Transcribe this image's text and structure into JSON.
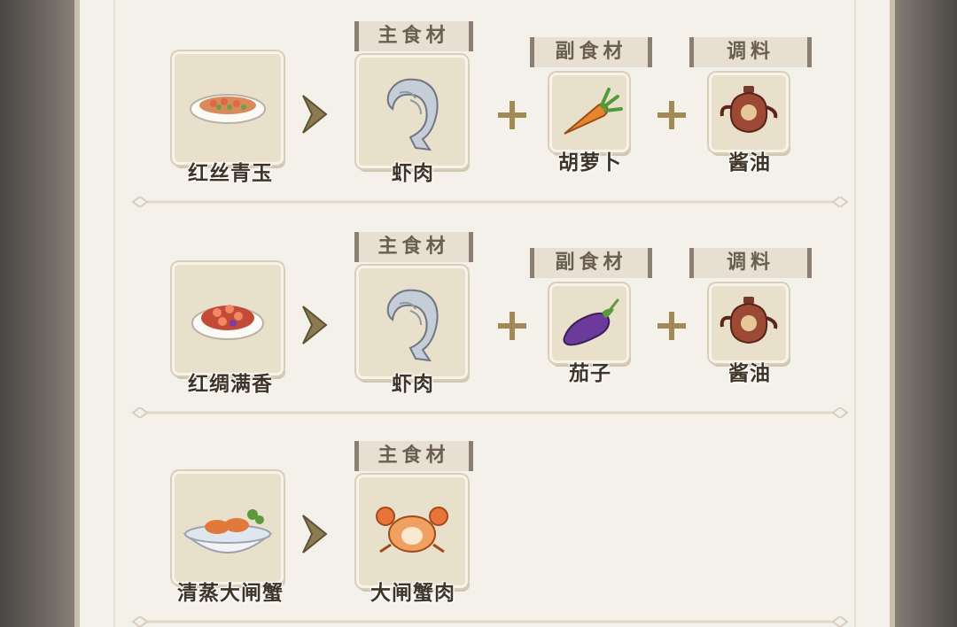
{
  "tags": {
    "main": "主食材",
    "side": "副食材",
    "seasoning": "调料"
  },
  "recipes": [
    {
      "dish": "红丝青玉",
      "main": "虾肉",
      "side": "胡萝卜",
      "seasoning": "酱油"
    },
    {
      "dish": "红绸满香",
      "main": "虾肉",
      "side": "茄子",
      "seasoning": "酱油"
    },
    {
      "dish": "清蒸大闸蟹",
      "main": "大闸蟹肉"
    }
  ],
  "icons": {
    "dish1": "shrimp-stirfry-plate-icon",
    "dish2": "red-shrimp-plate-icon",
    "dish3": "steamed-crab-bowl-icon",
    "shrimp": "shrimp-meat-icon",
    "carrot": "carrot-icon",
    "eggplant": "eggplant-icon",
    "soy": "soy-sauce-pot-icon",
    "crab": "crab-meat-icon"
  },
  "colors": {
    "panel": "#f4f1ea",
    "card": "#e9e0cb",
    "accent": "#8b7a52",
    "text": "#3e3428"
  }
}
